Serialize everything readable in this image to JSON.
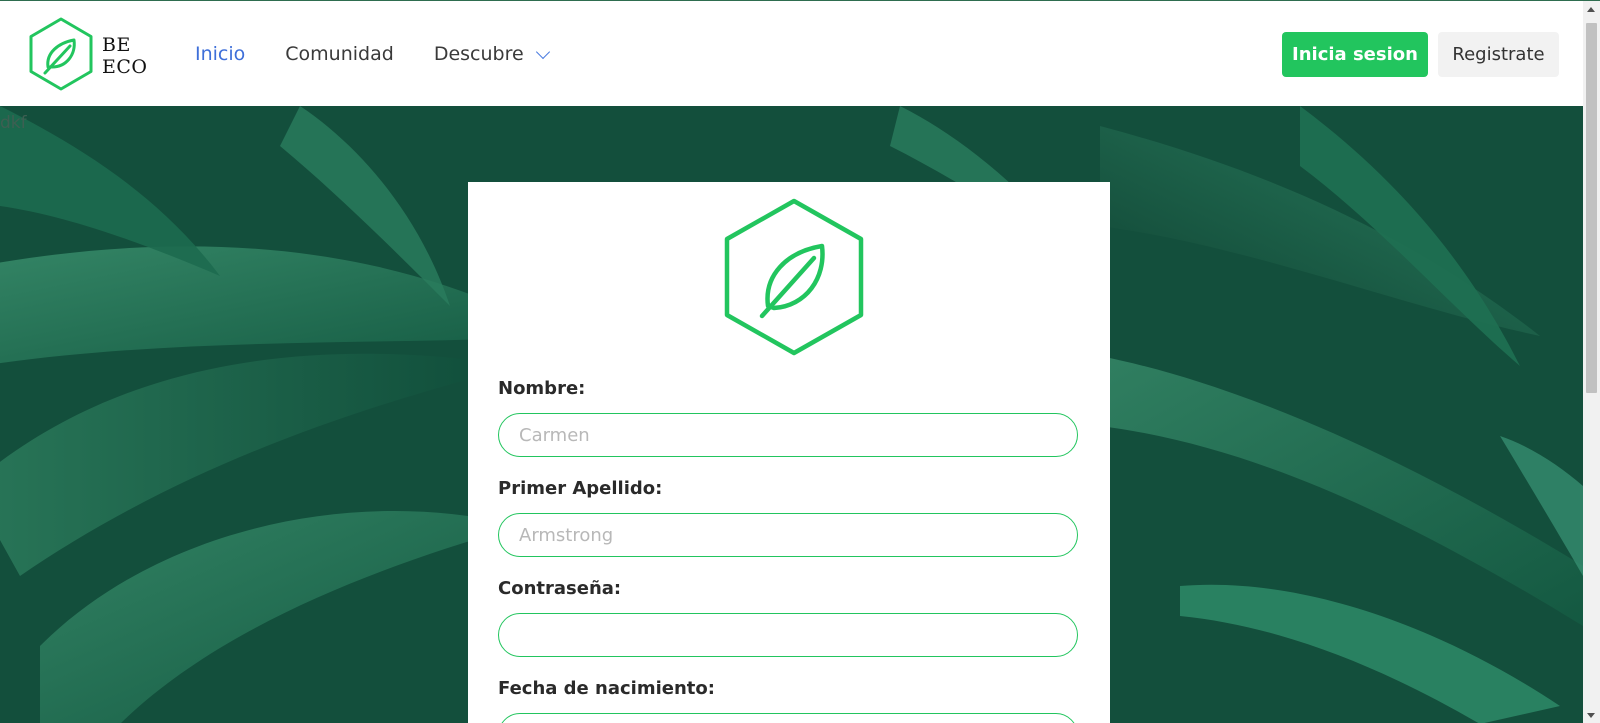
{
  "brand": {
    "line1": "BE",
    "line2": "ECO",
    "logo_icon": "leaf-hexagon-icon",
    "accent_color": "#22c55e"
  },
  "nav": {
    "items": [
      {
        "label": "Inicio",
        "active": true
      },
      {
        "label": "Comunidad",
        "active": false
      },
      {
        "label": "Descubre",
        "active": false,
        "dropdown_icon": "chevron-down-icon"
      }
    ]
  },
  "header_actions": {
    "login_label": "Inicia sesion",
    "register_label": "Registrate"
  },
  "hero": {
    "corner_text": "dkf"
  },
  "form": {
    "logo_icon": "leaf-hexagon-icon",
    "fields": [
      {
        "label": "Nombre:",
        "value": "",
        "placeholder": "Carmen",
        "type": "text"
      },
      {
        "label": "Primer Apellido:",
        "value": "",
        "placeholder": "Armstrong",
        "type": "text"
      },
      {
        "label": "Contraseña:",
        "value": "",
        "placeholder": "",
        "type": "password"
      },
      {
        "label": "Fecha de nacimiento:",
        "value": "",
        "placeholder": "",
        "type": "text"
      }
    ]
  }
}
